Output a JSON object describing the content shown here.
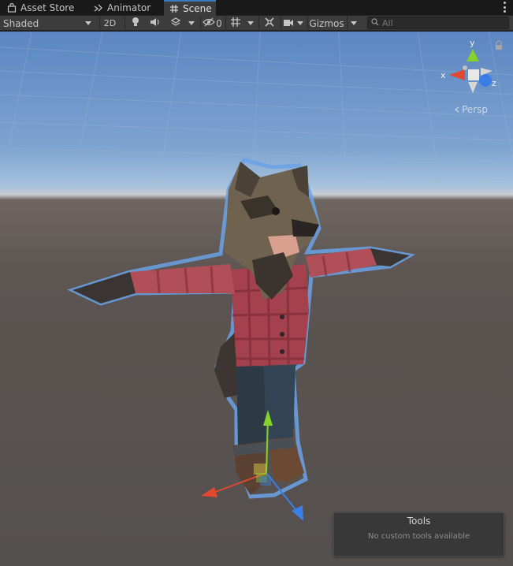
{
  "tabs": [
    {
      "label": "Asset Store",
      "icon": "bag-icon"
    },
    {
      "label": "Animator",
      "icon": "animator-icon"
    },
    {
      "label": "Scene",
      "icon": "grid-icon",
      "active": true
    }
  ],
  "toolbar": {
    "shading_mode": "Shaded",
    "mode_2d": "2D",
    "hidden_count": "0",
    "gizmos": "Gizmos",
    "search_placeholder": "All"
  },
  "scene": {
    "orientation_gizmo": {
      "x_label": "x",
      "y_label": "y",
      "z_label": "z"
    },
    "projection_label": "Persp"
  },
  "tools_overlay": {
    "title": "Tools",
    "subtitle": "No custom tools available"
  },
  "colors": {
    "accent": "#3a79bb",
    "x_axis": "#e2482f",
    "y_axis": "#84d22b",
    "z_axis": "#3a7ee8",
    "selection_outline": "#6aa2e6"
  }
}
